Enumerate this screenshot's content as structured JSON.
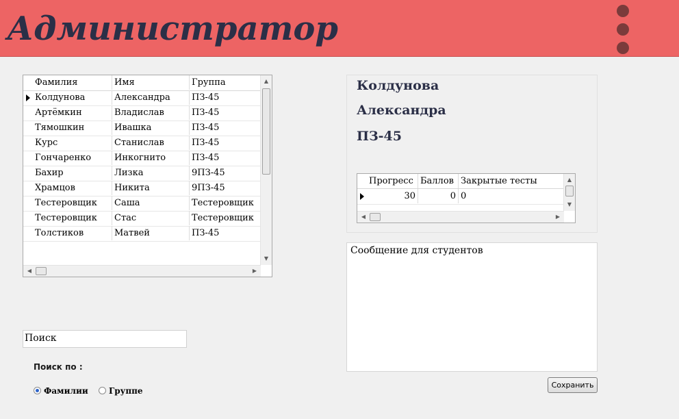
{
  "header": {
    "title": "Администратор"
  },
  "students": {
    "columns": [
      "Фамилия",
      "Имя",
      "Группа"
    ],
    "rows": [
      [
        "Колдунова",
        "Александра",
        "ПЗ-45"
      ],
      [
        "Артёмкин",
        "Владислав",
        "ПЗ-45"
      ],
      [
        "Тямошкин",
        "Ивашка",
        "ПЗ-45"
      ],
      [
        "Курс",
        "Станислав",
        "ПЗ-45"
      ],
      [
        "Гончаренко",
        "Инкогнито",
        "ПЗ-45"
      ],
      [
        "Бахир",
        "Лизка",
        "9ПЗ-45"
      ],
      [
        "Храмцов",
        "Никита",
        "9ПЗ-45"
      ],
      [
        "Тестеровщик",
        "Саша",
        "Тестеровщик"
      ],
      [
        "Тестеровщик",
        "Стас",
        "Тестеровщик"
      ],
      [
        "Толстиков",
        "Матвей",
        "ПЗ-45"
      ]
    ]
  },
  "search": {
    "value": "Поиск",
    "by_label": "Поиск по :",
    "option_lastname": "Фамилии",
    "option_group": "Группе"
  },
  "detail": {
    "last_name": "Колдунова",
    "first_name": "Александра",
    "group": "ПЗ-45",
    "progress": {
      "columns": [
        "Прогресс",
        "Баллов",
        "Закрытые тесты"
      ],
      "row": [
        "30",
        "0",
        "0"
      ]
    }
  },
  "message": {
    "text": "Сообщение для студентов"
  },
  "buttons": {
    "save": "Сохранить"
  },
  "colors": {
    "header_bg": "#ed6464",
    "title": "#2b2f47",
    "dots": "#7b3b3b"
  },
  "icons": [
    "menu-dots-icon",
    "row-pointer-icon",
    "scroll-up-icon",
    "scroll-down-icon",
    "scroll-left-icon",
    "scroll-right-icon"
  ]
}
